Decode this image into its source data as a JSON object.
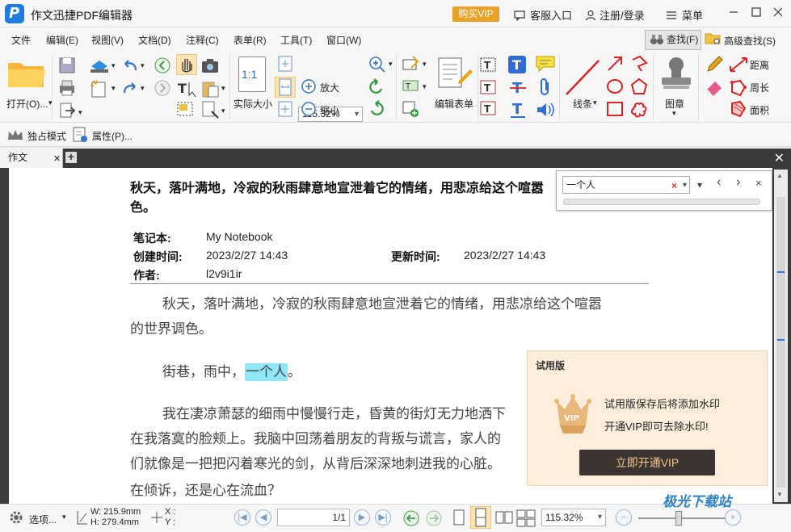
{
  "titlebar": {
    "title": "作文迅捷PDF编辑器",
    "vip": "购买VIP",
    "service": "客服入口",
    "login": "注册/登录",
    "menu": "菜单"
  },
  "menubar": {
    "items": [
      "文件",
      "编辑(E)",
      "视图(V)",
      "文档(D)",
      "注释(C)",
      "表单(R)",
      "工具(T)",
      "窗口(W)"
    ],
    "find": "查找(F)",
    "advanced_find": "高级查找(S)"
  },
  "toolbar": {
    "open": "打开(O)...",
    "actual_size": "实际大小",
    "zoom_value": "115.32%",
    "zoom_in": "放大",
    "zoom_out": "缩小",
    "edit_form": "编辑表单",
    "lines": "线条",
    "stamp": "图章",
    "distance": "距离",
    "perimeter": "周长",
    "area": "面积",
    "actual_size_icon": "1:1"
  },
  "subbar": {
    "exclusive": "独占模式",
    "properties": "属性(P)..."
  },
  "tabs": {
    "active": "作文"
  },
  "document": {
    "heading": "秋天，落叶满地，冷寂的秋雨肆意地宣泄着它的情绪，用悲凉给这个喧嚣的世界调色。",
    "heading_line1": "秋天，落叶满地，冷寂的秋雨肆意地宣泄着它的情绪，用悲凉给这个喧嚣",
    "heading_line2": "色。",
    "notebook_key": "笔记本:",
    "notebook_val": "My Notebook",
    "created_key": "创建时间:",
    "created_val": "2023/2/27 14:43",
    "updated_key": "更新时间:",
    "updated_val": "2023/2/27 14:43",
    "author_key": "作者:",
    "author_val": "l2v9i1ir",
    "p1_line1": "秋天，落叶满地，冷寂的秋雨肆意地宣泄着它的情绪，用悲凉给这个喧嚣",
    "p1_line2": "的世界调色。",
    "p2_pre": "街巷，雨中，",
    "p2_hl": "一个人",
    "p2_post": "。",
    "p3_line1": "我在凄凉萧瑟的细雨中慢慢行走，昏黄的街灯无力地洒下",
    "p3_line2": "在我落寞的脸颊上。我脑中回荡着朋友的背叛与谎言，家人的",
    "p3_line3": "们就像是一把把闪着寒光的剑，从背后深深地刺进我的心脏。",
    "p3_line4": "在倾诉，还是心在流血？"
  },
  "search": {
    "query": "一个人",
    "clear": "×",
    "dropdown": "▾",
    "more": "▾",
    "prev": "‹",
    "next": "›",
    "close": "×"
  },
  "trial": {
    "header": "试用版",
    "line1": "试用版保存后将添加水印",
    "line2": "开通VIP即可去除水印!",
    "button": "立即开通VIP",
    "badge": "VIP"
  },
  "status": {
    "options": "选项...",
    "width": "W: 215.9mm",
    "height": "H: 279.4mm",
    "x": "X :",
    "y": "Y :",
    "page": "1/1",
    "zoom": "115.32%"
  },
  "watermark": "极光下载站",
  "colors": {
    "accent_blue": "#1e7be0",
    "vip_orange": "#e8a227",
    "highlight": "#8fe7f8",
    "trial_bg": "#fdeedb",
    "trial_button": "#3b3431"
  }
}
